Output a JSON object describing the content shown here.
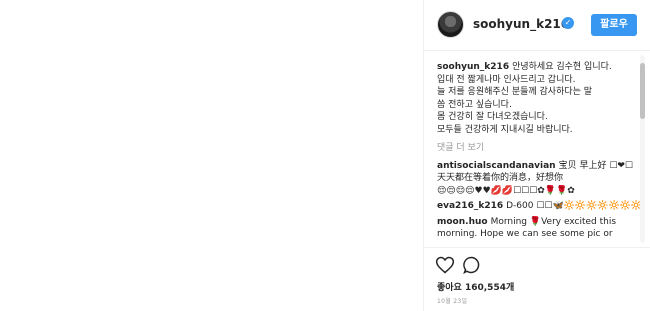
{
  "header": {
    "username": "soohyun_k216",
    "follow_label": "팔로우"
  },
  "caption": {
    "username": "soohyun_k216",
    "lines": [
      "안녕하세요 김수현 입니다.",
      "입대 전 짧게나마 인사드리고 갑니다.",
      "늘 저를 응원해주신 분들께 감사하다는 말",
      "씀 전하고 싶습니다.",
      "몸 건강히 잘 다녀오겠습니다.",
      "모두들 건강하게 지내시길 바랍니다."
    ]
  },
  "load_more_label": "댓글 더 보기",
  "comments": [
    {
      "username": "antisocialscandanavian",
      "text_1": "宝贝 早上好 ☐❤☐",
      "text_2": "天天都在等着你的消息，好想你",
      "text_3": "😌😌😌😌♥♥💋💋☐☐☐✿🌹🌹✿"
    },
    {
      "username": "eva216_k216",
      "text_1": "D-600 ☐☐🦋🔆🔆🔆🔆🔆🔆🔆"
    },
    {
      "username": "moon.huo",
      "text_1": "Morning 🌹Very excited this",
      "text_2": "morning. Hope we can see some pic or"
    }
  ],
  "likes_label": "좋아요 160,554개",
  "date_label": "10월 23일",
  "icons": {
    "heart": "heart-icon",
    "comment": "comment-icon",
    "verified": "verified-badge-icon"
  },
  "colors": {
    "accent": "#3897f0",
    "muted": "#999999",
    "text": "#262626"
  }
}
